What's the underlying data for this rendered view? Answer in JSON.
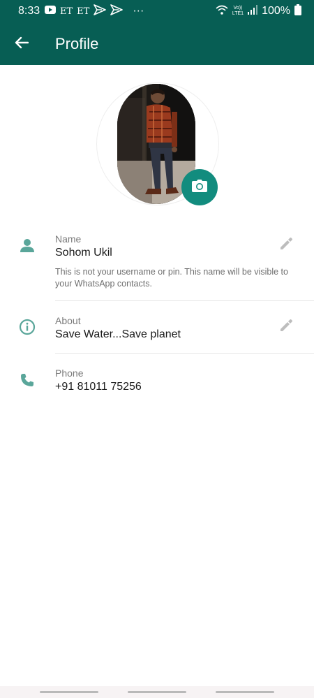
{
  "status_bar": {
    "time": "8:33",
    "et_1": "ET",
    "et_2": "ET",
    "more": "···",
    "volte_top": "Vo))",
    "volte_bottom": "LTE1",
    "battery": "100%"
  },
  "header": {
    "title": "Profile"
  },
  "fields": {
    "name": {
      "label": "Name",
      "value": "Sohom Ukil",
      "hint": "This is not your username or pin. This name will be visible to your WhatsApp contacts."
    },
    "about": {
      "label": "About",
      "value": "Save Water...Save planet"
    },
    "phone": {
      "label": "Phone",
      "value": "+91 81011 75256"
    }
  },
  "colors": {
    "primary_dark": "#075e54",
    "accent": "#128c7e",
    "icon_teal": "#5aa69a",
    "edit_grey": "#bdbdbd"
  },
  "icons": [
    "back-arrow-icon",
    "camera-icon",
    "person-icon",
    "info-icon",
    "phone-icon",
    "pencil-icon",
    "youtube-icon",
    "send-icon",
    "wifi-icon",
    "signal-icon",
    "battery-icon"
  ]
}
